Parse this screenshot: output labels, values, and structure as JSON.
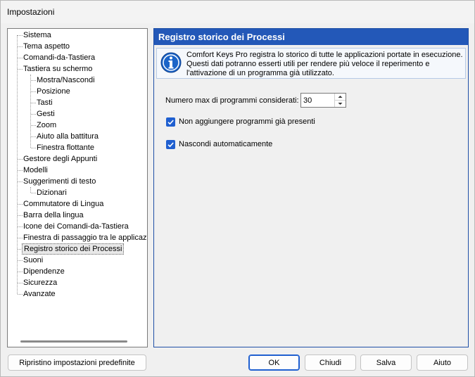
{
  "window": {
    "title": "Impostazioni"
  },
  "tree": {
    "items": [
      {
        "label": "Sistema",
        "level": 0
      },
      {
        "label": "Tema aspetto",
        "level": 0
      },
      {
        "label": "Comandi-da-Tastiera",
        "level": 0
      },
      {
        "label": "Tastiera su schermo",
        "level": 0
      },
      {
        "label": "Mostra/Nascondi",
        "level": 1
      },
      {
        "label": "Posizione",
        "level": 1
      },
      {
        "label": "Tasti",
        "level": 1
      },
      {
        "label": "Gesti",
        "level": 1
      },
      {
        "label": "Zoom",
        "level": 1
      },
      {
        "label": "Aiuto alla battitura",
        "level": 1
      },
      {
        "label": "Finestra flottante",
        "level": 1
      },
      {
        "label": "Gestore degli Appunti",
        "level": 0
      },
      {
        "label": "Modelli",
        "level": 0
      },
      {
        "label": "Suggerimenti di testo",
        "level": 0
      },
      {
        "label": "Dizionari",
        "level": 1
      },
      {
        "label": "Commutatore di Lingua",
        "level": 0
      },
      {
        "label": "Barra della lingua",
        "level": 0
      },
      {
        "label": "Icone dei Comandi-da-Tastiera",
        "level": 0
      },
      {
        "label": "Finestra di passaggio tra le applicazioni",
        "level": 0
      },
      {
        "label": "Registro storico dei Processi",
        "level": 0,
        "selected": true
      },
      {
        "label": "Suoni",
        "level": 0
      },
      {
        "label": "Dipendenze",
        "level": 0
      },
      {
        "label": "Sicurezza",
        "level": 0
      },
      {
        "label": "Avanzate",
        "level": 0
      }
    ]
  },
  "panel": {
    "header": "Registro storico dei Processi",
    "info_text": "Comfort Keys Pro registra lo storico di tutte le applicazioni portate in esecuzione. Questi dati potranno esserti utili per rendere più veloce il reperimento e l'attivazione di un programma già utilizzato.",
    "max_programs_label": "Numero max di programmi considerati:",
    "max_programs_value": "30",
    "checkbox_no_duplicates": {
      "label": "Non aggiungere programmi già presenti",
      "checked": true
    },
    "checkbox_auto_hide": {
      "label": "Nascondi automaticamente",
      "checked": true
    }
  },
  "buttons": {
    "reset": "Ripristino impostazioni predefinite",
    "ok": "OK",
    "close": "Chiudi",
    "save": "Salva",
    "help": "Aiuto"
  },
  "colors": {
    "accent": "#2358b8",
    "checkbox": "#1f5fd0",
    "info_icon": "#1b64c8"
  }
}
